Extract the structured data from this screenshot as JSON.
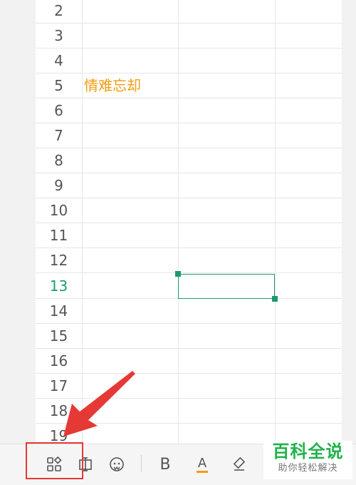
{
  "sheet": {
    "rows": [
      "2",
      "3",
      "4",
      "5",
      "6",
      "7",
      "8",
      "9",
      "10",
      "11",
      "12",
      "13",
      "14",
      "15",
      "16",
      "17",
      "18",
      "19"
    ],
    "active_row": "13",
    "cell_text": "情难忘却"
  },
  "toolbar": {
    "icons": [
      "apps-grid-icon",
      "text-box-icon",
      "face-emoji-icon",
      "bold-icon",
      "font-color-icon",
      "eraser-icon"
    ],
    "bold_label": "B",
    "font_color_label": "A",
    "font_color_accent": "#f39c12"
  },
  "watermark": {
    "title": "百科全说",
    "subtitle": "助你轻松解决"
  },
  "annotation_color": "#e53935",
  "accent_color": "#1a9b6c"
}
